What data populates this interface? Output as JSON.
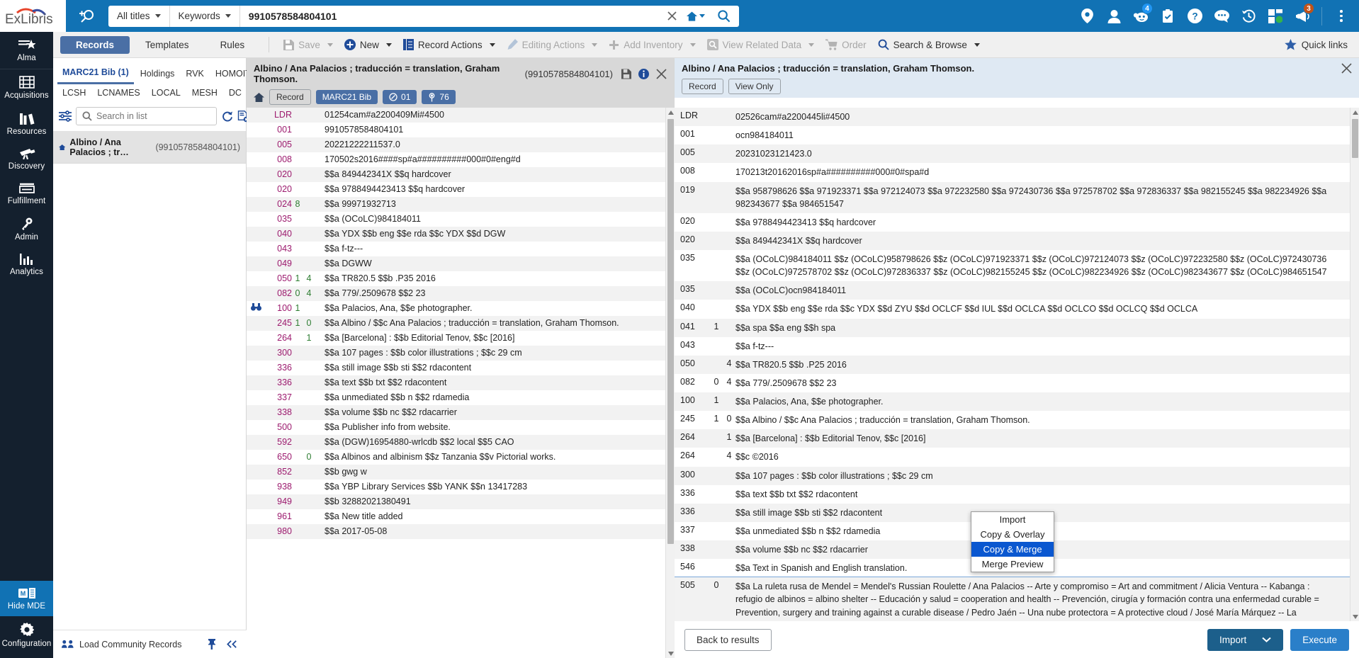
{
  "brand": {
    "name": "ExLibris",
    "accent": "#1172b4"
  },
  "topbar": {
    "search_icon": "add-search-icon",
    "scope_selector": "All titles",
    "field_selector": "Keywords",
    "query_value": "9910578584804101",
    "query_placeholder": "Search",
    "clear_label": "✕",
    "icons": [
      {
        "name": "location-pin-icon",
        "badge": null
      },
      {
        "name": "user-icon",
        "badge": null
      },
      {
        "name": "tasks-robot-icon",
        "badge": "4",
        "badge_color": "#2196f3"
      },
      {
        "name": "clipboard-check-icon",
        "badge": null
      },
      {
        "name": "help-question-icon",
        "badge": null
      },
      {
        "name": "chat-bubble-icon",
        "badge": null
      },
      {
        "name": "recent-history-icon",
        "badge": null
      },
      {
        "name": "apps-grid-icon",
        "badge": null
      },
      {
        "name": "announcements-megaphone-icon",
        "badge": "3",
        "badge_color": "#c0531a"
      }
    ],
    "overflow_label": "kebab-menu"
  },
  "leftnav": {
    "items": [
      {
        "label": "Alma",
        "icon": "alma-star-icon",
        "active": false
      },
      {
        "label": "Acquisitions",
        "icon": "acquisitions-icon",
        "active": false
      },
      {
        "label": "Resources",
        "icon": "resources-books-icon",
        "active": false
      },
      {
        "label": "Discovery",
        "icon": "discovery-telescope-icon",
        "active": false
      },
      {
        "label": "Fulfillment",
        "icon": "fulfillment-tray-icon",
        "active": false
      },
      {
        "label": "Admin",
        "icon": "admin-key-icon",
        "active": false
      },
      {
        "label": "Analytics",
        "icon": "analytics-bars-icon",
        "active": false
      }
    ],
    "bottom": [
      {
        "label": "Hide MDE",
        "icon": "mde-icon",
        "active": true
      },
      {
        "label": "Configuration",
        "icon": "gear-icon",
        "active": false
      }
    ]
  },
  "toolbar": {
    "tabs": [
      {
        "label": "Records",
        "active": true
      },
      {
        "label": "Templates",
        "active": false
      },
      {
        "label": "Rules",
        "active": false
      }
    ],
    "buttons": [
      {
        "label": "Save",
        "icon": "save-disk-icon",
        "disabled": true,
        "caret": true
      },
      {
        "label": "New",
        "icon": "plus-circle-icon",
        "disabled": false,
        "caret": true
      },
      {
        "label": "Record Actions",
        "icon": "record-actions-icon",
        "disabled": false,
        "caret": true
      },
      {
        "label": "Editing Actions",
        "icon": "pencil-icon",
        "disabled": true,
        "caret": true
      },
      {
        "label": "Add Inventory",
        "icon": "plus-icon",
        "disabled": true,
        "caret": true
      },
      {
        "label": "View Related Data",
        "icon": "magnify-square-icon",
        "disabled": true,
        "caret": true
      },
      {
        "label": "Order",
        "icon": "cart-icon",
        "disabled": true,
        "caret": false
      },
      {
        "label": "Search & Browse",
        "icon": "search-icon",
        "disabled": false,
        "caret": true
      }
    ],
    "quick_links": {
      "label": "Quick links",
      "icon": "star-icon"
    }
  },
  "leftpanel": {
    "tabs_row1": [
      {
        "label": "MARC21 Bib (1)",
        "active": true
      },
      {
        "label": "Holdings",
        "active": false
      },
      {
        "label": "RVK",
        "active": false
      },
      {
        "label": "HOMOIT",
        "active": false
      }
    ],
    "tabs_row2": [
      {
        "label": "LCSH",
        "active": false
      },
      {
        "label": "LCNAMES",
        "active": false
      },
      {
        "label": "LOCAL",
        "active": false
      },
      {
        "label": "MESH",
        "active": false
      },
      {
        "label": "DC",
        "active": false
      }
    ],
    "filter_icon": "filter-sliders-icon",
    "search_placeholder": "Search in list",
    "search_value": "",
    "tool_icons": [
      "refresh-icon",
      "clear-list-icon",
      "split-view-icon"
    ],
    "records": [
      {
        "icon": "home-icon",
        "title": "Albino / Ana Palacios ; tr…",
        "id": "(9910578584804101)"
      }
    ],
    "footer": {
      "load_label": "Load Community Records",
      "load_icon": "community-icon",
      "pin_icon": "pin-icon",
      "collapse_icon": "collapse-left-icon"
    }
  },
  "center": {
    "title": "Albino / Ana Palacios ; traducción = translation, Graham Thomson.",
    "id": "(9910578584804101)",
    "head_icons": [
      "save-disk-icon",
      "info-icon",
      "close-icon"
    ],
    "home_icon": "home-icon",
    "chips": [
      {
        "label": "Record",
        "style": "outline"
      },
      {
        "label": "MARC21 Bib",
        "style": "solid"
      },
      {
        "label": "01",
        "style": "solid",
        "icon": "holdings-icon"
      },
      {
        "label": "76",
        "style": "solid",
        "icon": "items-icon"
      }
    ],
    "fields": [
      {
        "tag": "LDR",
        "i1": "",
        "i2": "",
        "data": "01254cam#a2200409Mi#4500",
        "gutter": ""
      },
      {
        "tag": "001",
        "i1": "",
        "i2": "",
        "data": "9910578584804101",
        "gutter": ""
      },
      {
        "tag": "005",
        "i1": "",
        "i2": "",
        "data": "20221222211537.0",
        "gutter": ""
      },
      {
        "tag": "008",
        "i1": "",
        "i2": "",
        "data": "170502s2016####sp#a##########000#0#eng#d",
        "gutter": ""
      },
      {
        "tag": "020",
        "i1": "",
        "i2": "",
        "data": "$$a 849442341X $$q hardcover",
        "gutter": ""
      },
      {
        "tag": "020",
        "i1": "",
        "i2": "",
        "data": "$$a 9788494423413 $$q hardcover",
        "gutter": ""
      },
      {
        "tag": "024",
        "i1": "8",
        "i2": "",
        "data": "$$a 99971932713",
        "gutter": ""
      },
      {
        "tag": "035",
        "i1": "",
        "i2": "",
        "data": "$$a (OCoLC)984184011",
        "gutter": ""
      },
      {
        "tag": "040",
        "i1": "",
        "i2": "",
        "data": "$$a YDX $$b eng $$e rda $$c YDX $$d DGW",
        "gutter": ""
      },
      {
        "tag": "043",
        "i1": "",
        "i2": "",
        "data": "$$a f-tz---",
        "gutter": ""
      },
      {
        "tag": "049",
        "i1": "",
        "i2": "",
        "data": "$$a DGWW",
        "gutter": ""
      },
      {
        "tag": "050",
        "i1": "1",
        "i2": "4",
        "data": "$$a TR820.5 $$b .P35 2016",
        "gutter": ""
      },
      {
        "tag": "082",
        "i1": "0",
        "i2": "4",
        "data": "$$a 779/.2509678 $$2 23",
        "gutter": ""
      },
      {
        "tag": "100",
        "i1": "1",
        "i2": "",
        "data": "$$a Palacios, Ana, $$e photographer.",
        "gutter": "binoculars-icon"
      },
      {
        "tag": "245",
        "i1": "1",
        "i2": "0",
        "data": "$$a Albino / $$c Ana Palacios ; traducción = translation, Graham Thomson.",
        "gutter": ""
      },
      {
        "tag": "264",
        "i1": "",
        "i2": "1",
        "data": "$$a [Barcelona] : $$b Editorial Tenov, $$c [2016]",
        "gutter": ""
      },
      {
        "tag": "300",
        "i1": "",
        "i2": "",
        "data": "$$a 107 pages : $$b color illustrations ; $$c 29 cm",
        "gutter": ""
      },
      {
        "tag": "336",
        "i1": "",
        "i2": "",
        "data": "$$a still image $$b sti $$2 rdacontent",
        "gutter": ""
      },
      {
        "tag": "336",
        "i1": "",
        "i2": "",
        "data": "$$a text $$b txt $$2 rdacontent",
        "gutter": ""
      },
      {
        "tag": "337",
        "i1": "",
        "i2": "",
        "data": "$$a unmediated $$b n $$2 rdamedia",
        "gutter": ""
      },
      {
        "tag": "338",
        "i1": "",
        "i2": "",
        "data": "$$a volume $$b nc $$2 rdacarrier",
        "gutter": ""
      },
      {
        "tag": "500",
        "i1": "",
        "i2": "",
        "data": "$$a Publisher info from website.",
        "gutter": ""
      },
      {
        "tag": "592",
        "i1": "",
        "i2": "",
        "data": "$$a (DGW)16954880-wrlcdb $$2 local $$5 CAO",
        "gutter": ""
      },
      {
        "tag": "650",
        "i1": "",
        "i2": "0",
        "data": "$$a Albinos and albinism $$z Tanzania $$v Pictorial works.",
        "gutter": ""
      },
      {
        "tag": "852",
        "i1": "",
        "i2": "",
        "data": "$$b gwg w",
        "gutter": ""
      },
      {
        "tag": "938",
        "i1": "",
        "i2": "",
        "data": "$$a YBP Library Services $$b YANK $$n 13417283",
        "gutter": ""
      },
      {
        "tag": "949",
        "i1": "",
        "i2": "",
        "data": "$$b 32882021380491",
        "gutter": ""
      },
      {
        "tag": "961",
        "i1": "",
        "i2": "",
        "data": "$$a New title added",
        "gutter": ""
      },
      {
        "tag": "980",
        "i1": "",
        "i2": "",
        "data": "$$a 2017-05-08",
        "gutter": ""
      }
    ]
  },
  "right": {
    "title": "Albino / Ana Palacios ; traducción = translation, Graham Thomson.",
    "close_icon": "close-icon",
    "chips": [
      {
        "label": "Record",
        "style": "outline"
      },
      {
        "label": "View Only",
        "style": "outline"
      }
    ],
    "fields": [
      {
        "tag": "LDR",
        "i1": "",
        "i2": "",
        "data": "02526cam#a2200445li#4500"
      },
      {
        "tag": "001",
        "i1": "",
        "i2": "",
        "data": "ocn984184011"
      },
      {
        "tag": "005",
        "i1": "",
        "i2": "",
        "data": "20231023121423.0"
      },
      {
        "tag": "008",
        "i1": "",
        "i2": "",
        "data": "170213t20162016sp#a##########000#0#spa#d"
      },
      {
        "tag": "019",
        "i1": "",
        "i2": "",
        "data": "$$a 958798626 $$a 971923371 $$a 972124073 $$a 972232580 $$a 972430736 $$a 972578702 $$a 972836337 $$a 982155245 $$a 982234926 $$a 982343677 $$a 984651547"
      },
      {
        "tag": "020",
        "i1": "",
        "i2": "",
        "data": "$$a 9788494423413 $$q hardcover"
      },
      {
        "tag": "020",
        "i1": "",
        "i2": "",
        "data": "$$a 849442341X $$q hardcover"
      },
      {
        "tag": "035",
        "i1": "",
        "i2": "",
        "data": "$$a (OCoLC)984184011 $$z (OCoLC)958798626 $$z (OCoLC)971923371 $$z (OCoLC)972124073 $$z (OCoLC)972232580 $$z (OCoLC)972430736 $$z (OCoLC)972578702 $$z (OCoLC)972836337 $$z (OCoLC)982155245 $$z (OCoLC)982234926 $$z (OCoLC)982343677 $$z (OCoLC)984651547"
      },
      {
        "tag": "035",
        "i1": "",
        "i2": "",
        "data": "$$a (OCoLC)ocn984184011"
      },
      {
        "tag": "040",
        "i1": "",
        "i2": "",
        "data": "$$a YDX $$b eng $$e rda $$c YDX $$d ZYU $$d OCLCF $$d IUL $$d OCLCA $$d OCLCO $$d OCLCQ $$d OCLCA"
      },
      {
        "tag": "041",
        "i1": "1",
        "i2": "",
        "data": "$$a spa $$a eng $$h spa"
      },
      {
        "tag": "043",
        "i1": "",
        "i2": "",
        "data": "$$a f-tz---"
      },
      {
        "tag": "050",
        "i1": "",
        "i2": "4",
        "data": "$$a TR820.5 $$b .P25 2016"
      },
      {
        "tag": "082",
        "i1": "0",
        "i2": "4",
        "data": "$$a 779/.2509678 $$2 23"
      },
      {
        "tag": "100",
        "i1": "1",
        "i2": "",
        "data": "$$a Palacios, Ana, $$e photographer."
      },
      {
        "tag": "245",
        "i1": "1",
        "i2": "0",
        "data": "$$a Albino / $$c Ana Palacios ; traducción = translation, Graham Thomson."
      },
      {
        "tag": "264",
        "i1": "",
        "i2": "1",
        "data": "$$a [Barcelona] : $$b Editorial Tenov, $$c [2016]"
      },
      {
        "tag": "264",
        "i1": "",
        "i2": "4",
        "data": "$$c ©2016"
      },
      {
        "tag": "300",
        "i1": "",
        "i2": "",
        "data": "$$a 107 pages : $$b color illustrations ; $$c 29 cm"
      },
      {
        "tag": "336",
        "i1": "",
        "i2": "",
        "data": "$$a text $$b txt $$2 rdacontent"
      },
      {
        "tag": "336",
        "i1": "",
        "i2": "",
        "data": "$$a still image $$b sti $$2 rdacontent"
      },
      {
        "tag": "337",
        "i1": "",
        "i2": "",
        "data": "$$a unmediated $$b n $$2 rdamedia"
      },
      {
        "tag": "338",
        "i1": "",
        "i2": "",
        "data": "$$a volume $$b nc $$2 rdacarrier"
      },
      {
        "tag": "546",
        "i1": "",
        "i2": "",
        "data": "$$a Text in Spanish and English translation."
      },
      {
        "tag": "505",
        "i1": "0",
        "i2": "",
        "data": "$$a La ruleta rusa de Mendel = Mendel's Russian Roulette / Ana Palacios -- Arte y compromiso = Art and commitment / Alicia Ventura -- Kabanga : refugio de albinos = albino shelter -- Educación y salud = cooperation and health -- Prevención, cirugía y formación contra una enfermedad curable = Prevention, surgery and training against a curable disease / Pedro Jaén -- Una nube protectora = A protective cloud / José María Márquez -- La prevención, el mejor tratamiento = Prevention, the best"
      }
    ],
    "footer": {
      "back_label": "Back to results",
      "import_label": "Import",
      "execute_label": "Execute"
    },
    "import_menu": {
      "open": true,
      "items": [
        {
          "label": "Import",
          "selected": false
        },
        {
          "label": "Copy & Overlay",
          "selected": false
        },
        {
          "label": "Copy & Merge",
          "selected": true
        },
        {
          "label": "Merge Preview",
          "selected": false
        }
      ]
    }
  }
}
